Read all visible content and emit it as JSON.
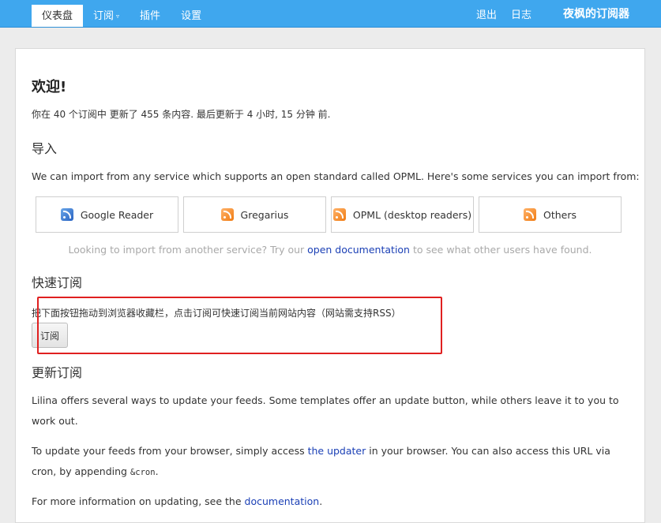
{
  "nav": {
    "tabs": [
      {
        "label": "仪表盘"
      },
      {
        "label": "订阅"
      },
      {
        "label": "插件"
      },
      {
        "label": "设置"
      }
    ],
    "dropdown_caret": "▿",
    "logout": "退出",
    "log": "日志",
    "brand": "夜枫的订阅器"
  },
  "welcome": {
    "title": "欢迎!",
    "stats": "你在 40 个订阅中 更新了 455 条内容. 最后更新于 4 小时, 15 分钟 前."
  },
  "import": {
    "heading": "导入",
    "description": "We can import from any service which supports an open standard called OPML. Here's some services you can import from:",
    "services": [
      {
        "label": "Google Reader",
        "icon": "google-reader-icon"
      },
      {
        "label": "Gregarius",
        "icon": "rss-icon"
      },
      {
        "label": "OPML (desktop readers)",
        "icon": "rss-icon"
      },
      {
        "label": "Others",
        "icon": "rss-icon"
      }
    ],
    "hint_before": "Looking to import from another service? Try our ",
    "hint_link": "open documentation",
    "hint_after": " to see what other users have found."
  },
  "quick_subscribe": {
    "heading": "快速订阅",
    "description": "把下面按钮拖动到浏览器收藏栏，点击订阅可快速订阅当前网站内容（网站需支持RSS）",
    "button": "订阅",
    "highlight_color": "#e02020"
  },
  "update": {
    "heading": "更新订阅",
    "para1": "Lilina offers several ways to update your feeds. Some templates offer an update button, while others leave it to you to work out.",
    "para2_before": "To update your feeds from your browser, simply access ",
    "para2_link": "the updater",
    "para2_mid": " in your browser. You can also access this URL via cron, by appending ",
    "para2_code": "&cron",
    "para2_end": ".",
    "para3_before": "For more information on updating, see the ",
    "para3_link": "documentation",
    "para3_end": "."
  },
  "colors": {
    "topbar": "#3fa7ee",
    "link": "#1a3fb5",
    "hint": "#a9a9a9"
  }
}
